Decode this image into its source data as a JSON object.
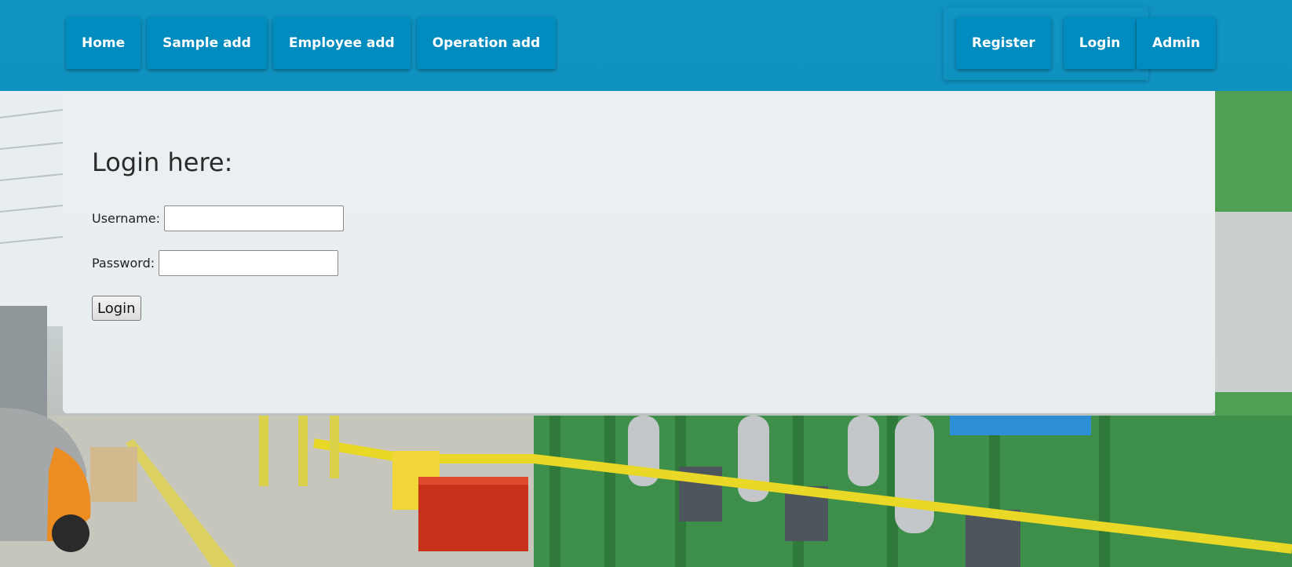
{
  "nav": {
    "left_items": [
      {
        "label": "Home"
      },
      {
        "label": "Sample add"
      },
      {
        "label": "Employee add"
      },
      {
        "label": "Operation add"
      }
    ],
    "right_items": [
      {
        "label": "Register"
      },
      {
        "label": "Login"
      }
    ],
    "admin_label": "Admin"
  },
  "login_form": {
    "title": "Login here:",
    "username_label": "Username:",
    "username_value": "",
    "password_label": "Password:",
    "password_value": "",
    "submit_label": "Login"
  },
  "colors": {
    "navbar": "#008cbe",
    "panel": "#eceff1",
    "nav_text": "#ffffff"
  }
}
